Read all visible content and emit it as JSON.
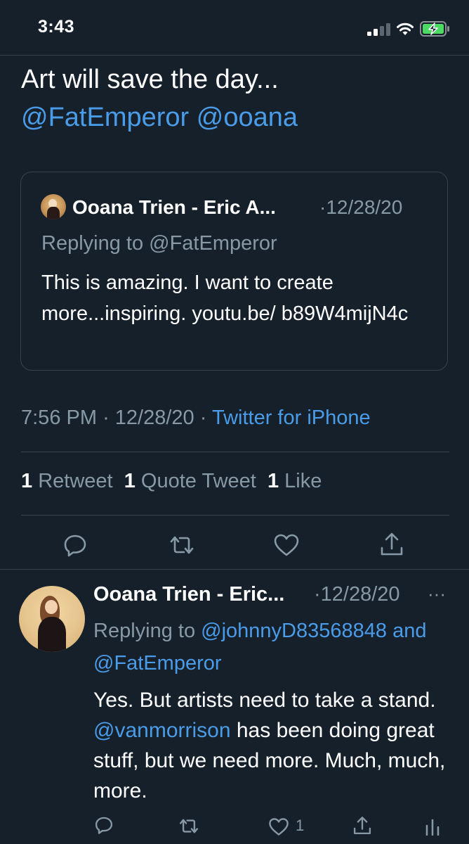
{
  "status_bar": {
    "time": "3:43"
  },
  "tweet": {
    "text": "Art will save the day...",
    "mentions": "@FatEmperor @ooana",
    "quoted": {
      "author": "Ooana Trien - Eric A...",
      "date": "·12/28/20",
      "replying_to": "Replying to @FatEmperor",
      "text": "This is amazing. I want to create more...inspiring. youtu.be/ b89W4mijN4c"
    },
    "time": "7:56 PM",
    "date": "12/28/20",
    "sep": "·",
    "source": "Twitter for iPhone",
    "stats": {
      "retweet_count": "1",
      "retweet_label": "Retweet",
      "quote_count": "1",
      "quote_label": "Quote Tweet",
      "like_count": "1",
      "like_label": "Like"
    }
  },
  "reply": {
    "author": "Ooana Trien - Eric...",
    "date": "·12/28/20",
    "more": "···",
    "replying_prefix": "Replying to",
    "replying_user1": "@johnnyD83568848",
    "replying_and": "and",
    "replying_user2": "@FatEmperor",
    "text_part1": "Yes. But artists need to take a stand.",
    "text_mention": "@vanmorrison",
    "text_part2": "has been doing great stuff, but we need more. Much, much, more.",
    "like_count": "1"
  },
  "icons": [
    "reply-icon",
    "retweet-icon",
    "like-icon",
    "share-icon",
    "analytics-icon",
    "more-icon",
    "wifi-icon",
    "battery-icon",
    "signal-icon"
  ],
  "colors": {
    "background": "#15202b",
    "accent": "#4a9ce8",
    "secondary_text": "#8899a6",
    "divider": "#38444d",
    "battery_charge": "#4cd964"
  }
}
